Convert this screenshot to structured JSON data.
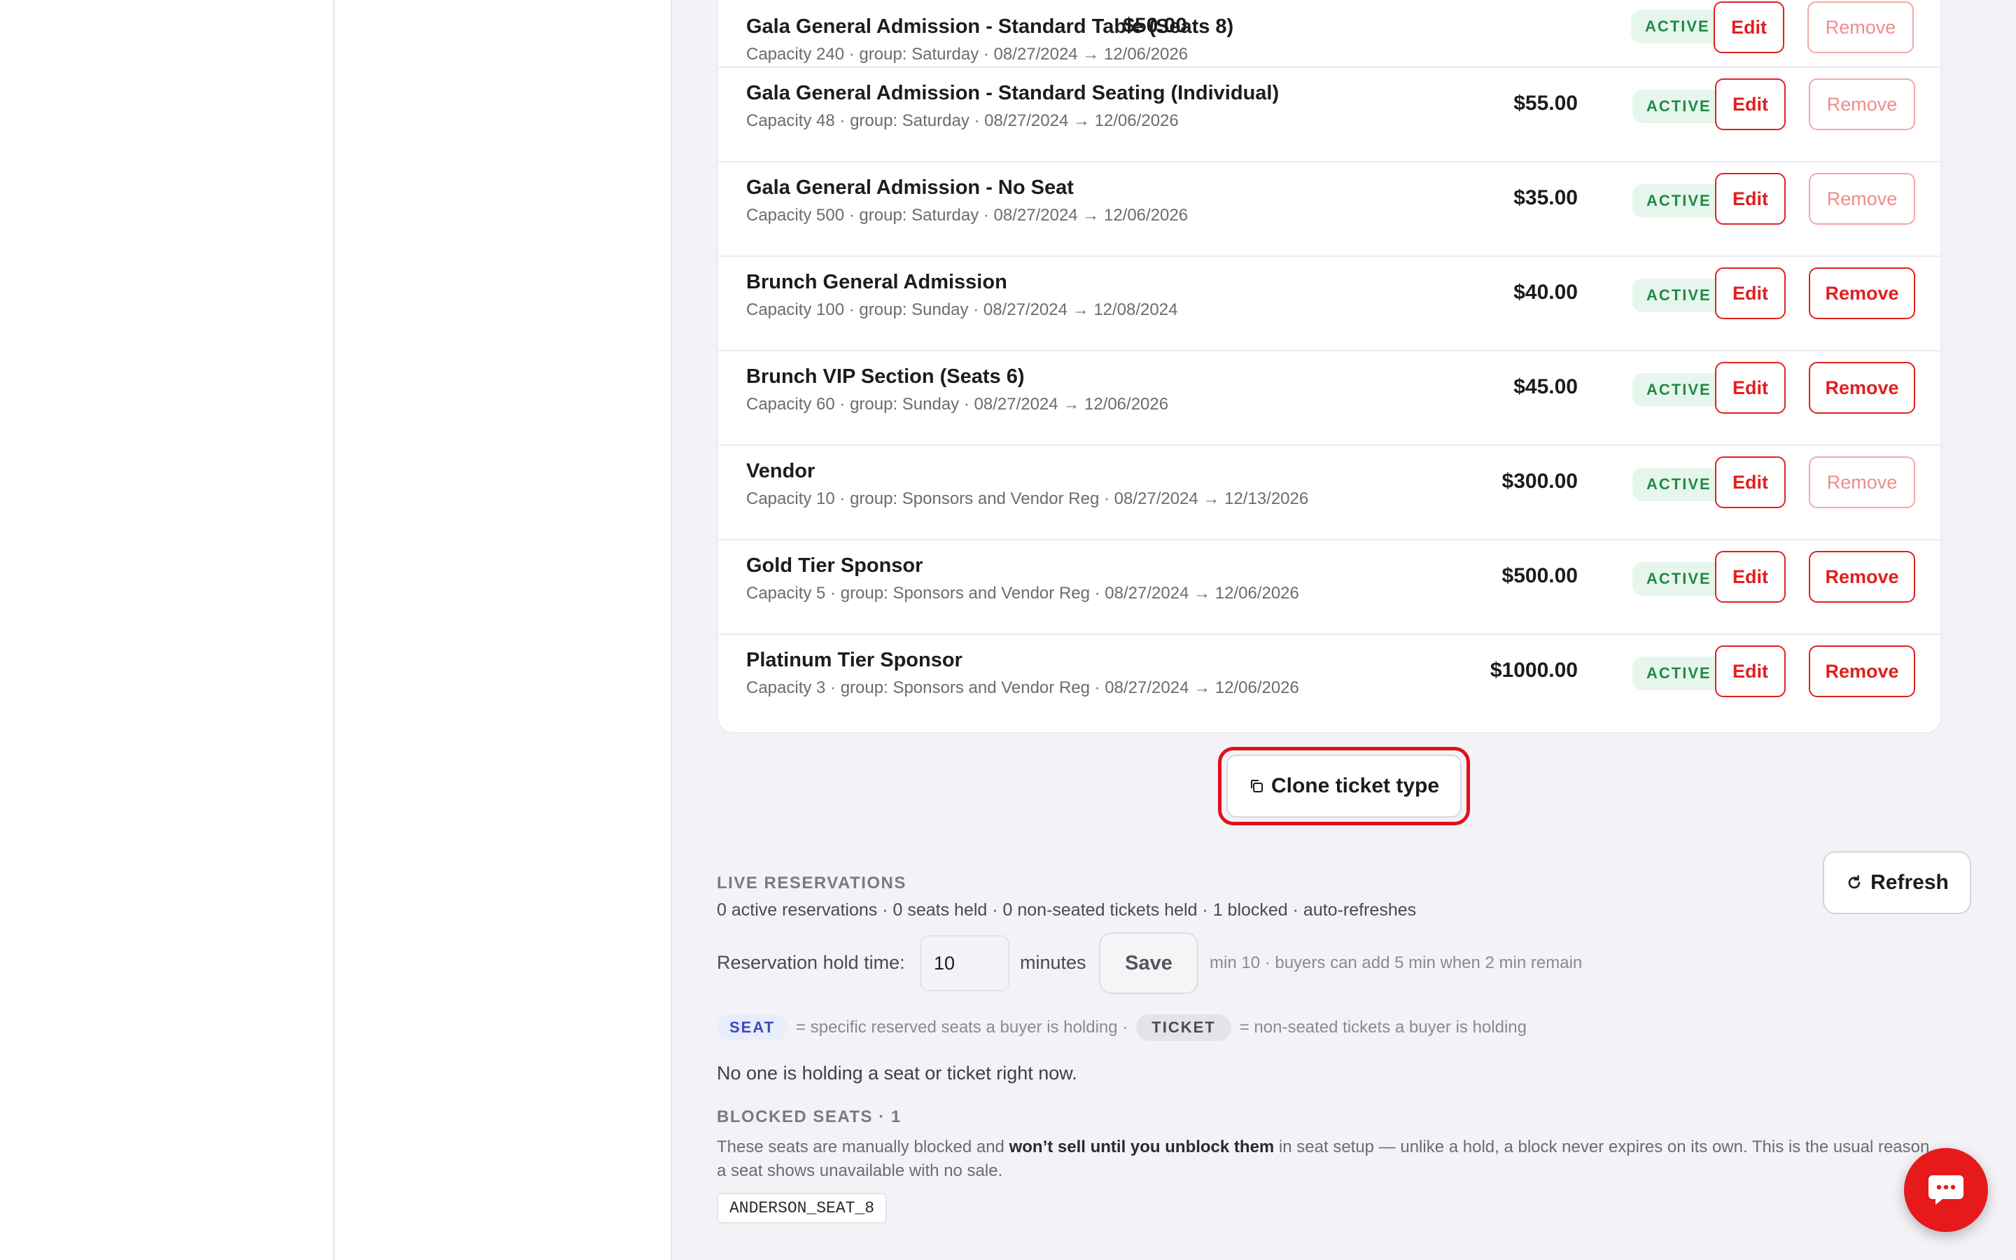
{
  "ticket_types": [
    {
      "name": "Gala General Admission - Standard Table (Seats 8)",
      "meta": "Capacity 240 · group: Saturday · 08/27/2024 → 12/06/2026",
      "price": "$50.00",
      "status": "ACTIVE",
      "edit": "Edit",
      "remove": "Remove"
    },
    {
      "name": "Gala General Admission - Standard Seating (Individual)",
      "meta": "Capacity 48 · group: Saturday · 08/27/2024 → 12/06/2026",
      "price": "$55.00",
      "status": "ACTIVE",
      "edit": "Edit",
      "remove": "Remove"
    },
    {
      "name": "Gala General Admission - No Seat",
      "meta": "Capacity 500 · group: Saturday · 08/27/2024 → 12/06/2026",
      "price": "$35.00",
      "status": "ACTIVE",
      "edit": "Edit",
      "remove": "Remove"
    },
    {
      "name": "Brunch General Admission",
      "meta": "Capacity 100 · group: Sunday · 08/27/2024 → 12/08/2024",
      "price": "$40.00",
      "status": "ACTIVE",
      "edit": "Edit",
      "remove": "Remove"
    },
    {
      "name": "Brunch VIP Section (Seats 6)",
      "meta": "Capacity 60 · group: Sunday · 08/27/2024 → 12/06/2026",
      "price": "$45.00",
      "status": "ACTIVE",
      "edit": "Edit",
      "remove": "Remove"
    },
    {
      "name": "Vendor",
      "meta": "Capacity 10 · group: Sponsors and Vendor Reg · 08/27/2024 → 12/13/2026",
      "price": "$300.00",
      "status": "ACTIVE",
      "edit": "Edit",
      "remove": "Remove"
    },
    {
      "name": "Gold Tier Sponsor",
      "meta": "Capacity 5 · group: Sponsors and Vendor Reg · 08/27/2024 → 12/06/2026",
      "price": "$500.00",
      "status": "ACTIVE",
      "edit": "Edit",
      "remove": "Remove"
    },
    {
      "name": "Platinum Tier Sponsor",
      "meta": "Capacity 3 · group: Sponsors and Vendor Reg · 08/27/2024 → 12/06/2026",
      "price": "$1000.00",
      "status": "ACTIVE",
      "edit": "Edit",
      "remove": "Remove"
    }
  ],
  "clone_button": {
    "icon": "copy-icon",
    "label": "Clone ticket type"
  },
  "live_reservations": {
    "title": "LIVE RESERVATIONS",
    "summary": "0 active reservations · 0 seats held · 0 non-seated tickets held · 1 blocked · auto-refreshes",
    "refresh_label": "Refresh",
    "hold_label": "Reservation hold time:",
    "hold_value": "10",
    "minutes_label": "minutes",
    "save_label": "Save",
    "hold_hint": "min 10 · buyers can add 5 min when 2 min remain",
    "legend_seat_pill": "SEAT",
    "legend_seat_text": "= specific reserved seats a buyer is holding ·",
    "legend_ticket_pill": "TICKET",
    "legend_ticket_text": "= non-seated tickets a buyer is holding",
    "empty_message": "No one is holding a seat or ticket right now."
  },
  "blocked_seats": {
    "title": "BLOCKED SEATS · 1",
    "desc_before": "These seats are manually blocked and ",
    "desc_bold": "won’t sell until you unblock them",
    "desc_after": " in seat setup — unlike a hold, a block never expires on its own. This is the usual reason a seat shows unavailable with no sale.",
    "seats": [
      "ANDERSON_SEAT_8"
    ]
  },
  "colors": {
    "accent": "#e0201f",
    "active_bg": "#e7f6ec",
    "active_fg": "#1f8a45",
    "seat_pill": "#3b4bbf"
  }
}
